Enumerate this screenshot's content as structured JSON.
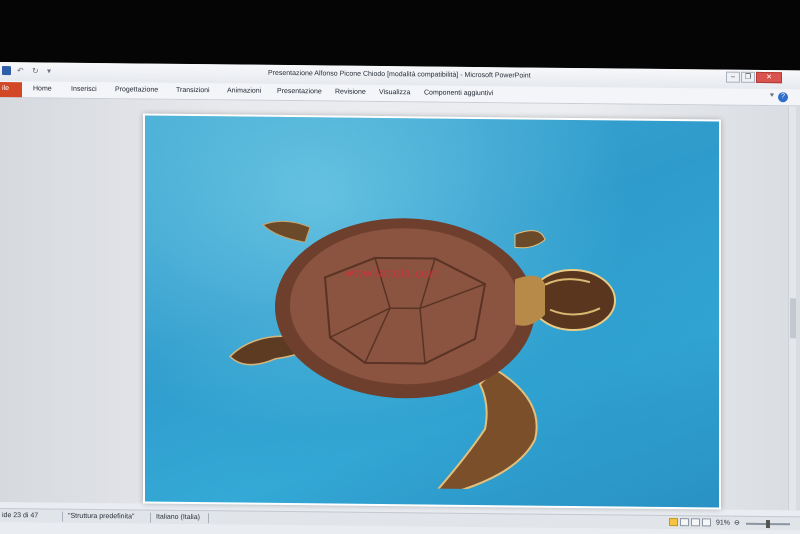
{
  "window": {
    "title": "Presentazione Alfonso Picone Chiodo [modalità compatibilità] - Microsoft PowerPoint",
    "minimize_glyph": "–",
    "restore_glyph": "❐",
    "close_glyph": "✕"
  },
  "quick_access": {
    "undo_glyph": "↶",
    "redo_glyph": "↻",
    "more_glyph": "▾"
  },
  "ribbon": {
    "file_tab": "ile",
    "tabs": [
      "Home",
      "Inserisci",
      "Progettazione",
      "Transizioni",
      "Animazioni",
      "Presentazione",
      "Revisione",
      "Visualizza",
      "Componenti aggiuntivi"
    ],
    "help_glyph": "?",
    "minimize_glyph": "♥"
  },
  "slide": {
    "watermark": "www.lattola.com"
  },
  "statusbar": {
    "slide_info": "ide 23 di 47",
    "theme": "\"Struttura predefinita\"",
    "language": "Italiano (Italia)",
    "zoom": "91%",
    "zoom_out_glyph": "⊖",
    "zoom_level": 0.5
  },
  "icons": {
    "save": "save-icon",
    "undo": "undo-icon",
    "redo": "redo-icon",
    "help": "help-icon"
  },
  "colors": {
    "file_tab": "#d24726",
    "close_button": "#d9534f",
    "water": "#2e9bcc"
  }
}
